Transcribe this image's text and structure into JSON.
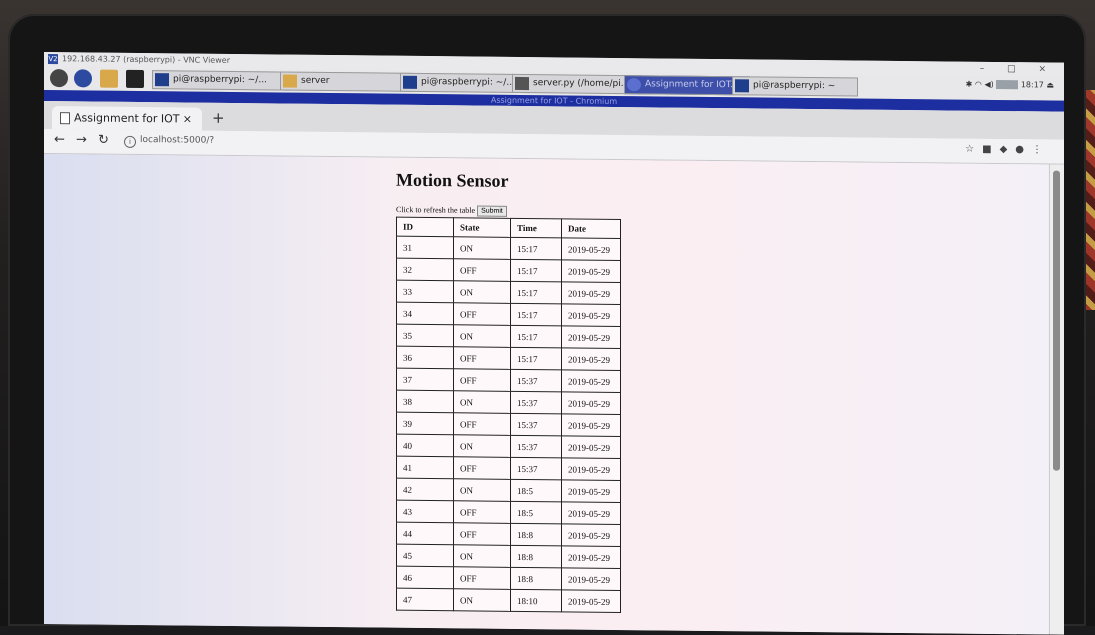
{
  "vnc": {
    "title": "192.168.43.27 (raspberrypi) - VNC Viewer",
    "controls": "– □ ×"
  },
  "taskbar": {
    "items": [
      {
        "label": "pi@raspberrypi: ~/..."
      },
      {
        "label": "server"
      },
      {
        "label": "pi@raspberrypi: ~/..."
      },
      {
        "label": "server.py (/home/pi..."
      },
      {
        "label": "Assignment for IOT..."
      },
      {
        "label": "pi@raspberrypi: ~"
      }
    ],
    "clock": "18:17"
  },
  "browser": {
    "window_title": "Assignment for IOT - Chromium",
    "tab_label": "Assignment for IOT",
    "tab_close": "×",
    "new_tab": "+",
    "url": "localhost:5000/?"
  },
  "page": {
    "heading": "Motion Sensor",
    "refresh_text": "Click to refresh the table",
    "submit_label": "Submit",
    "columns": [
      "ID",
      "State",
      "Time",
      "Date"
    ],
    "rows": [
      [
        "31",
        "ON",
        "15:17",
        "2019-05-29"
      ],
      [
        "32",
        "OFF",
        "15:17",
        "2019-05-29"
      ],
      [
        "33",
        "ON",
        "15:17",
        "2019-05-29"
      ],
      [
        "34",
        "OFF",
        "15:17",
        "2019-05-29"
      ],
      [
        "35",
        "ON",
        "15:17",
        "2019-05-29"
      ],
      [
        "36",
        "OFF",
        "15:17",
        "2019-05-29"
      ],
      [
        "37",
        "OFF",
        "15:37",
        "2019-05-29"
      ],
      [
        "38",
        "ON",
        "15:37",
        "2019-05-29"
      ],
      [
        "39",
        "OFF",
        "15:37",
        "2019-05-29"
      ],
      [
        "40",
        "ON",
        "15:37",
        "2019-05-29"
      ],
      [
        "41",
        "OFF",
        "15:37",
        "2019-05-29"
      ],
      [
        "42",
        "ON",
        "18:5",
        "2019-05-29"
      ],
      [
        "43",
        "OFF",
        "18:5",
        "2019-05-29"
      ],
      [
        "44",
        "OFF",
        "18:8",
        "2019-05-29"
      ],
      [
        "45",
        "ON",
        "18:8",
        "2019-05-29"
      ],
      [
        "46",
        "OFF",
        "18:8",
        "2019-05-29"
      ],
      [
        "47",
        "ON",
        "18:10",
        "2019-05-29"
      ]
    ]
  },
  "colors": {
    "taskbar_active": "#3d4fa8",
    "chromium_strip": "#1d2ea0"
  }
}
